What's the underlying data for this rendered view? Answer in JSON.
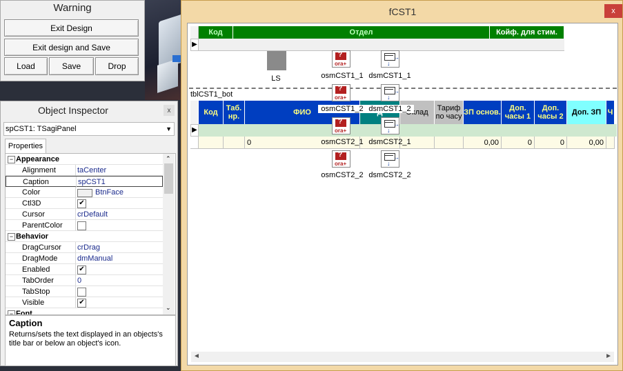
{
  "warning_panel": {
    "title": "Warning",
    "exit_design": "Exit Design",
    "exit_design_save": "Exit design and Save",
    "load": "Load",
    "save": "Save",
    "drop": "Drop"
  },
  "inspector": {
    "title": "Object Inspector",
    "close_glyph": "x",
    "selected_object": "spCST1: TSagiPanel",
    "tab_properties": "Properties",
    "rows": [
      {
        "kind": "cat",
        "expander": "−",
        "name": "Appearance"
      },
      {
        "kind": "prop",
        "name": "Alignment",
        "value": "taCenter"
      },
      {
        "kind": "prop",
        "name": "Caption",
        "value": "spCST1",
        "selected": true
      },
      {
        "kind": "color",
        "name": "Color",
        "value": "BtnFace"
      },
      {
        "kind": "check",
        "name": "Ctl3D",
        "value": "✔"
      },
      {
        "kind": "prop",
        "name": "Cursor",
        "value": "crDefault"
      },
      {
        "kind": "check",
        "name": "ParentColor",
        "value": ""
      },
      {
        "kind": "cat",
        "expander": "−",
        "name": "Behavior"
      },
      {
        "kind": "prop",
        "name": "DragCursor",
        "value": "crDrag"
      },
      {
        "kind": "prop",
        "name": "DragMode",
        "value": "dmManual"
      },
      {
        "kind": "check",
        "name": "Enabled",
        "value": "✔"
      },
      {
        "kind": "prop",
        "name": "TabOrder",
        "value": "0"
      },
      {
        "kind": "check",
        "name": "TabStop",
        "value": ""
      },
      {
        "kind": "check",
        "name": "Visible",
        "value": "✔"
      },
      {
        "kind": "cat",
        "expander": "−",
        "name": "Font"
      }
    ],
    "help_title": "Caption",
    "help_text": "Returns/sets the text displayed in an objects's title bar or below an object's icon."
  },
  "form": {
    "title": "fCST1",
    "close_glyph": "x",
    "top_grid": {
      "headers": [
        "Код",
        "Отдел",
        "Койф. для стим."
      ]
    },
    "ls_label": "LS",
    "components": [
      "osmCST1_1",
      "dsmCST1_1",
      "osmCST1_2",
      "dsmCST1_2",
      "osmCST2_1",
      "dsmCST2_1",
      "osmCST2_2",
      "dsmCST2_2"
    ],
    "icon_text": "ora+",
    "bot_label": "tblCST1_bot",
    "bot_grid": {
      "headers": [
        "Код",
        "Таб. нр.",
        "ФИО",
        "Д",
        "Оклад",
        "Тариф по часу",
        "ЗП основ.",
        "Доп. часы 1",
        "Доп. часы 2",
        "Доп. ЗП",
        "Ч"
      ],
      "row": [
        "",
        "",
        "0",
        "",
        "",
        "",
        "0,00",
        "0",
        "0",
        "0,00",
        ""
      ]
    },
    "scroll_left": "◄",
    "scroll_right": "►"
  }
}
